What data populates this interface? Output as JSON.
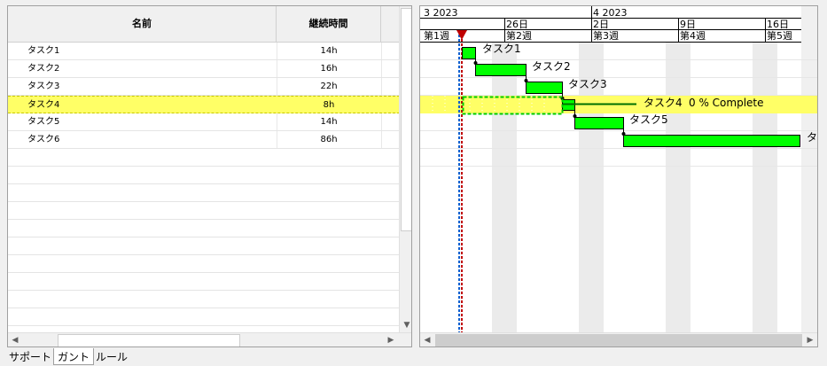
{
  "grid": {
    "columns": [
      "名前",
      "継続時間"
    ],
    "rows": [
      {
        "name": "タスク1",
        "duration": "14h",
        "selected": false
      },
      {
        "name": "タスク2",
        "duration": "16h",
        "selected": false
      },
      {
        "name": "タスク3",
        "duration": "22h",
        "selected": false
      },
      {
        "name": "タスク4",
        "duration": "8h",
        "selected": true
      },
      {
        "name": "タスク5",
        "duration": "14h",
        "selected": false
      },
      {
        "name": "タスク6",
        "duration": "86h",
        "selected": false
      }
    ]
  },
  "gantt": {
    "months": [
      "3 2023",
      "4 2023"
    ],
    "days": [
      "26日",
      "2日",
      "9日",
      "16日"
    ],
    "weeks": [
      "第1週",
      "第2週",
      "第3週",
      "第4週",
      "第5週"
    ],
    "bar_labels": [
      "タスク1",
      "タスク2",
      "タスク3",
      "タスク4",
      "タスク5",
      "タ"
    ],
    "progress_text": "0 % Complete",
    "colors": {
      "bar": "#00ff00",
      "selection": "#ffff66",
      "today_line": "#c00000",
      "marker": "#c00000"
    }
  },
  "tabs": [
    "サポート",
    "ガント",
    "ルール"
  ],
  "active_tab": "ガント",
  "icons": {
    "scroll_left": "◀",
    "scroll_right": "▶",
    "scroll_down": "▼",
    "scroll_up": "▲"
  }
}
